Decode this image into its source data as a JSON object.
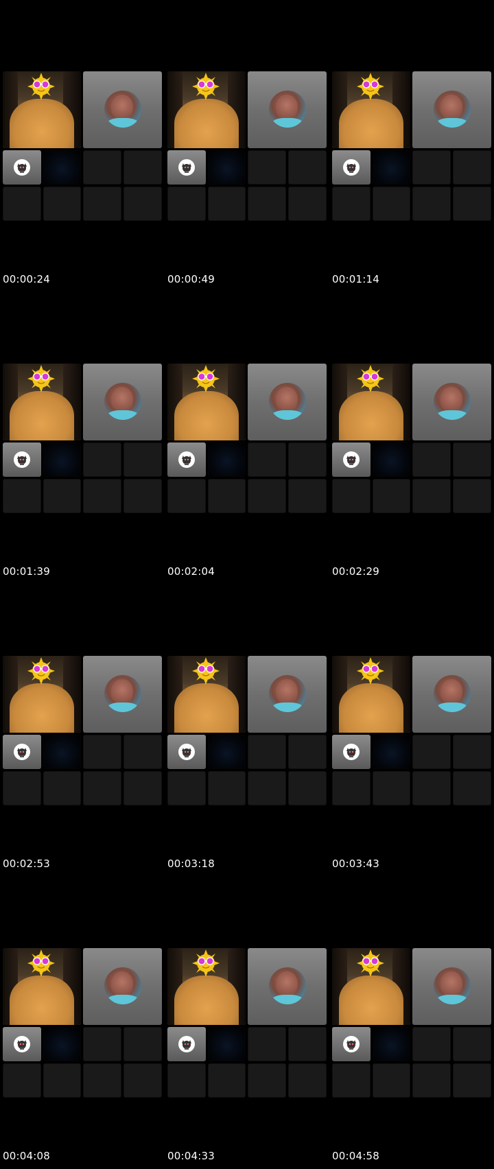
{
  "contact_sheet": {
    "thumbnails": [
      {
        "timestamp": "00:00:24"
      },
      {
        "timestamp": "00:00:49"
      },
      {
        "timestamp": "00:01:14"
      },
      {
        "timestamp": "00:01:39"
      },
      {
        "timestamp": "00:02:04"
      },
      {
        "timestamp": "00:02:29"
      },
      {
        "timestamp": "00:02:53"
      },
      {
        "timestamp": "00:03:18"
      },
      {
        "timestamp": "00:03:43"
      },
      {
        "timestamp": "00:04:08"
      },
      {
        "timestamp": "00:04:33"
      },
      {
        "timestamp": "00:04:58"
      }
    ]
  },
  "icons": {
    "sticker": "sun-with-glasses-icon",
    "avatar": "cat-avatar-icon"
  },
  "colors": {
    "background": "#000000",
    "tile_empty": "#1a1a1a",
    "timestamp_text": "#ffffff"
  }
}
